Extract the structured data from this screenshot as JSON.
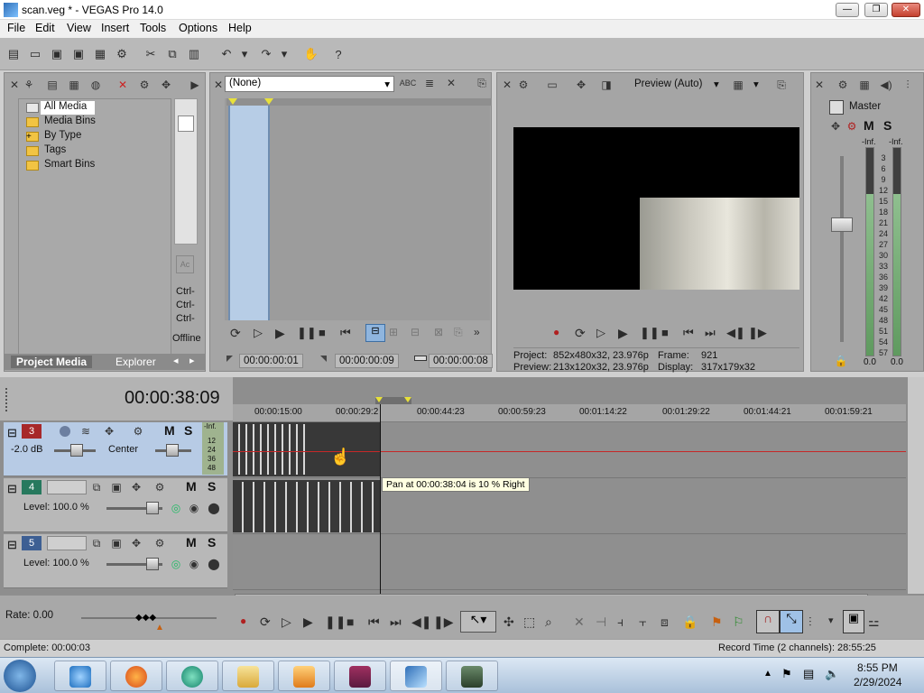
{
  "window": {
    "title": "scan.veg * - VEGAS Pro 14.0",
    "buttons": {
      "min": "—",
      "max": "❐",
      "close": "✕"
    }
  },
  "menu": [
    "File",
    "Edit",
    "View",
    "Insert",
    "Tools",
    "Options",
    "Help"
  ],
  "toolbar_icons": [
    "new-project-icon",
    "open-icon",
    "save-icon",
    "save-as-icon",
    "properties-icon",
    "cut-icon",
    "copy-icon",
    "paste-icon",
    "undo-icon",
    "redo-icon",
    "enable-snapping-icon",
    "help-icon"
  ],
  "project_media": {
    "tree": [
      "All Media",
      "Media Bins",
      "By Type",
      "Tags",
      "Smart Bins"
    ],
    "list_items": [
      "Ctrl-",
      "Ctrl-",
      "Ctrl-",
      "Offline"
    ],
    "tabs": [
      "Project Media",
      "Explorer"
    ]
  },
  "trimmer": {
    "selector": "(None)",
    "timecodes": [
      "00:00:00:01",
      "00:00:00:09",
      "00:00:00:08"
    ]
  },
  "preview": {
    "mode": "Preview (Auto)",
    "project_label": "Project:",
    "project_value": "852x480x32, 23.976p",
    "preview_label": "Preview:",
    "preview_value": "213x120x32, 23.976p",
    "frame_label": "Frame:",
    "frame_value": "921",
    "display_label": "Display:",
    "display_value": "317x179x32"
  },
  "master": {
    "title": "Master",
    "M": "M",
    "S": "S",
    "left_peak": "-Inf.",
    "right_peak": "-Inf.",
    "scale": [
      "3",
      "6",
      "9",
      "12",
      "15",
      "18",
      "21",
      "24",
      "27",
      "30",
      "33",
      "36",
      "39",
      "42",
      "45",
      "48",
      "51",
      "54",
      "57"
    ],
    "left_level": "0.0",
    "right_level": "0.0"
  },
  "timeline": {
    "time": "00:00:38:09",
    "ruler": [
      "00:00:15:00",
      "00:00:29:2",
      "00:00:44:23",
      "00:00:59:23",
      "00:01:14:22",
      "00:01:29:22",
      "00:01:44:21",
      "00:01:59:21"
    ],
    "tracks": [
      {
        "num": "3",
        "type": "audio",
        "vol": "-2.0 dB",
        "pan": "Center",
        "M": "M",
        "S": "S",
        "peak": "-Inf.",
        "meter": [
          "12",
          "24",
          "36",
          "48"
        ]
      },
      {
        "num": "4",
        "type": "video",
        "level": "Level: 100.0 %",
        "M": "M",
        "S": "S"
      },
      {
        "num": "5",
        "type": "video",
        "level": "Level: 100.0 %",
        "M": "M",
        "S": "S"
      }
    ],
    "tooltip": "Pan at 00:00:38:04 is 10 % Right"
  },
  "transport": {
    "rate": "Rate: 0.00"
  },
  "status": {
    "left": "Complete: 00:00:03",
    "right": "Record Time (2 channels): 28:55:25"
  },
  "taskbar": {
    "time": "8:55 PM",
    "date": "2/29/2024"
  },
  "colors": {
    "accent": "#b7cbe5",
    "redline": "#c62828",
    "tooltip": "#ffffe1"
  }
}
